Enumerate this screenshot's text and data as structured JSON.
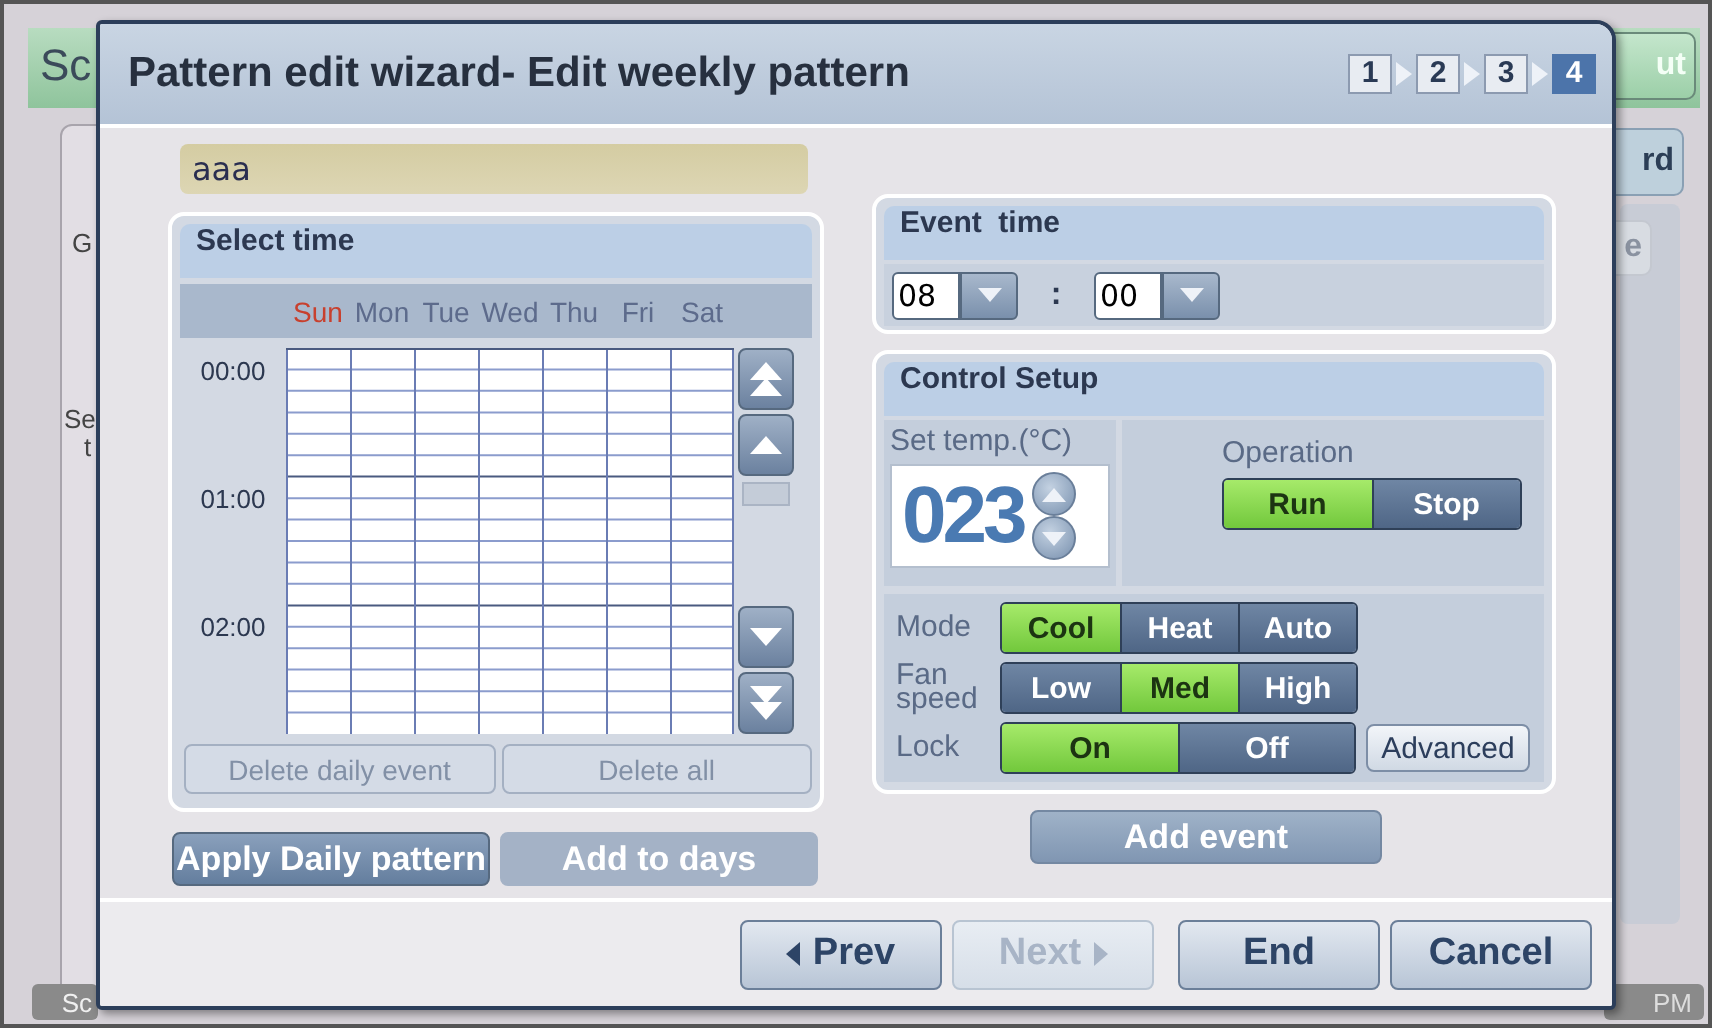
{
  "backdrop": {
    "header_title": "Sc",
    "header_button": "ut",
    "side_button": "rd",
    "side_texts": [
      "G",
      "Se",
      "t"
    ],
    "side_disabled_button": "e",
    "status_left": "Sc",
    "status_right": "PM"
  },
  "wizard": {
    "title": "Pattern edit wizard- Edit weekly pattern",
    "steps": [
      {
        "label": "1",
        "selected": false
      },
      {
        "label": "2",
        "selected": false
      },
      {
        "label": "3",
        "selected": false
      },
      {
        "label": "4",
        "selected": true
      }
    ],
    "pattern_name": "aaa",
    "select_time": {
      "title": "Select time",
      "days": [
        {
          "label": "Sun",
          "color": "#c8402e"
        },
        {
          "label": "Mon",
          "color": "#5d6b8c"
        },
        {
          "label": "Tue",
          "color": "#5d6b8c"
        },
        {
          "label": "Wed",
          "color": "#5d6b8c"
        },
        {
          "label": "Thu",
          "color": "#5d6b8c"
        },
        {
          "label": "Fri",
          "color": "#5d6b8c"
        },
        {
          "label": "Sat",
          "color": "#5d6b8c"
        }
      ],
      "times": [
        "00:00",
        "01:00",
        "02:00"
      ],
      "buttons": [
        {
          "label": "Delete daily event",
          "disabled": true
        },
        {
          "label": "Delete all",
          "disabled": true
        }
      ]
    },
    "daily_buttons": [
      {
        "label": "Apply Daily pattern",
        "disabled": false
      },
      {
        "label": "Add to days",
        "disabled": true
      }
    ],
    "event_time": {
      "title": "Event  time",
      "hour": "08",
      "separator": ":",
      "minute": "00"
    },
    "control_setup": {
      "title": "Control Setup",
      "set_temp_label": "Set temp.(°C)",
      "set_temp": "023",
      "operation_label": "Operation",
      "operation": [
        {
          "label": "Run",
          "selected": true
        },
        {
          "label": "Stop",
          "selected": false
        }
      ],
      "settings": [
        {
          "label": "Mode",
          "options": [
            {
              "label": "Cool",
              "selected": true
            },
            {
              "label": "Heat",
              "selected": false
            },
            {
              "label": "Auto",
              "selected": false
            }
          ]
        },
        {
          "label": "Fan speed",
          "options": [
            {
              "label": "Low",
              "selected": false
            },
            {
              "label": "Med",
              "selected": true
            },
            {
              "label": "High",
              "selected": false
            }
          ]
        },
        {
          "label": "Lock",
          "options": [
            {
              "label": "On",
              "selected": true
            },
            {
              "label": "Off",
              "selected": false
            }
          ]
        }
      ],
      "advanced": "Advanced"
    },
    "add_event": "Add event",
    "nav_buttons": [
      {
        "label": "Prev",
        "kind": "prev",
        "disabled": false
      },
      {
        "label": "Next",
        "kind": "next",
        "disabled": true
      },
      {
        "label": "End",
        "kind": "plain",
        "disabled": false
      },
      {
        "label": "Cancel",
        "kind": "plain",
        "disabled": false
      }
    ]
  }
}
